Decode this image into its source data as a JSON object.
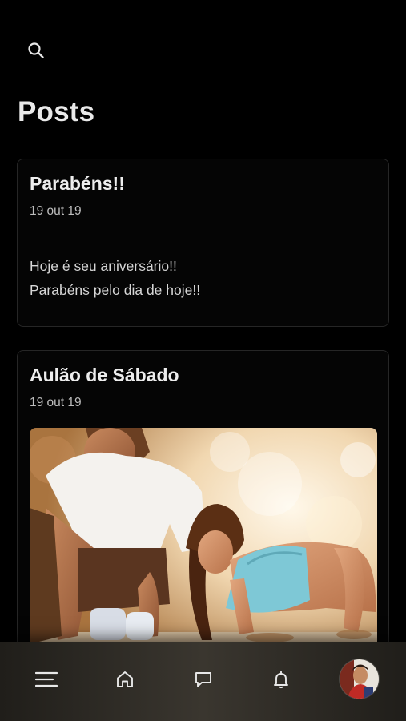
{
  "header": {
    "search_icon": "search-icon",
    "title": "Posts"
  },
  "posts": [
    {
      "title": "Parabéns!!",
      "date": "19 out 19",
      "body_lines": [
        "Hoje é seu aniversário!!",
        "Parabéns pelo dia de hoje!!"
      ]
    },
    {
      "title": "Aulão de Sábado",
      "date": "19 out 19",
      "image": "photo-workout-pushup"
    }
  ],
  "bottom_nav": {
    "items": [
      {
        "icon": "menu-icon"
      },
      {
        "icon": "home-icon"
      },
      {
        "icon": "chat-icon"
      },
      {
        "icon": "bell-icon"
      },
      {
        "icon": "avatar"
      }
    ]
  },
  "colors": {
    "background": "#000000",
    "card_border": "#262626",
    "text_primary": "#ededed",
    "text_secondary": "#bdbdbd",
    "nav_background": "#3a362f"
  }
}
